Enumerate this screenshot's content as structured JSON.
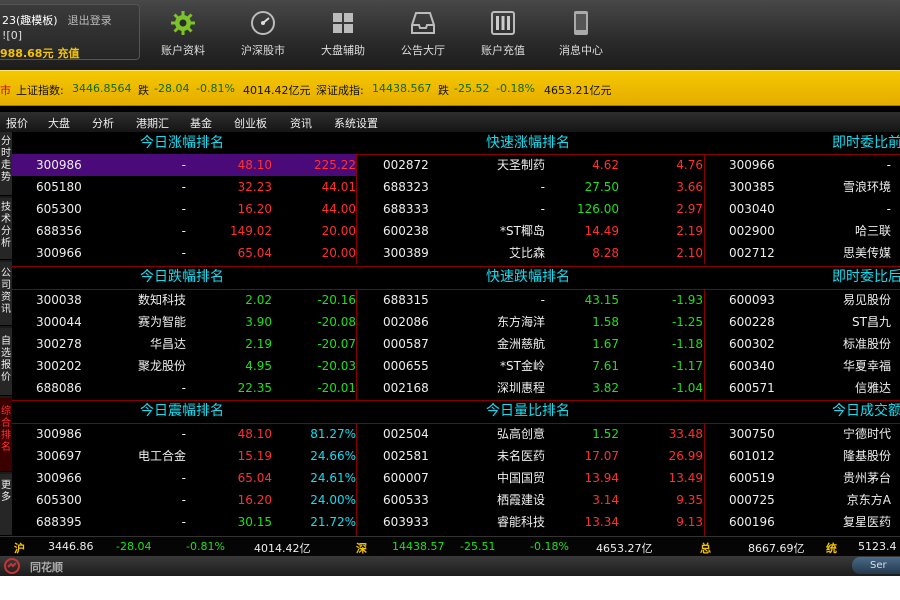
{
  "account": {
    "title": "23(趣模板)",
    "logout": "退出登录",
    "sub": "![0]",
    "balance": "988.68元",
    "recharge": "充值"
  },
  "nav": [
    {
      "label": "账户资料",
      "icon": "gear-icon"
    },
    {
      "label": "沪深股市",
      "icon": "gauge-icon"
    },
    {
      "label": "大盘辅助",
      "icon": "grid-icon"
    },
    {
      "label": "公告大厅",
      "icon": "inbox-icon"
    },
    {
      "label": "账户充值",
      "icon": "sliders-icon"
    },
    {
      "label": "消息中心",
      "icon": "phone-icon"
    }
  ],
  "ticker": {
    "lead": "市",
    "sh_label": "上证指数:",
    "sh_val": "3446.8564",
    "sh_dir": "跌",
    "sh_chg": "-28.04",
    "sh_pct": "-0.81%",
    "sh_amt": "4014.42亿元",
    "sz_label": "深证成指:",
    "sz_val": "14438.567",
    "sz_dir": "跌",
    "sz_chg": "-25.52",
    "sz_pct": "-0.18%",
    "sz_amt": "4653.21亿元"
  },
  "menu": [
    "报价",
    "大盘",
    "分析",
    "港期汇",
    "基金",
    "创业板",
    "资讯",
    "系统设置"
  ],
  "sidetabs": [
    "分时走势",
    "技术分析",
    "公司资讯",
    "自选报价",
    "综合排名",
    "更多"
  ],
  "panels": {
    "headers": [
      "今日涨幅排名",
      "快速涨幅排名",
      "即时委比前",
      "今日跌幅排名",
      "快速跌幅排名",
      "即时委比后",
      "今日震幅排名",
      "今日量比排名",
      "今日成交额"
    ],
    "block1": {
      "left": [
        [
          "300986",
          "-",
          "48.10",
          "225.22"
        ],
        [
          "605180",
          "-",
          "32.23",
          "44.01"
        ],
        [
          "605300",
          "-",
          "16.20",
          "44.00"
        ],
        [
          "688356",
          "-",
          "149.02",
          "20.00"
        ],
        [
          "300966",
          "-",
          "65.04",
          "20.00"
        ]
      ],
      "mid": [
        [
          "002872",
          "天圣制药",
          "4.62",
          "4.76"
        ],
        [
          "688323",
          "-",
          "27.50",
          "3.66"
        ],
        [
          "688333",
          "-",
          "126.00",
          "2.97"
        ],
        [
          "600238",
          "*ST椰岛",
          "14.49",
          "2.19"
        ],
        [
          "300389",
          "艾比森",
          "8.28",
          "2.10"
        ]
      ],
      "right": [
        [
          "300966",
          "-"
        ],
        [
          "300385",
          "雪浪环境"
        ],
        [
          "003040",
          "-"
        ],
        [
          "002900",
          "哈三联"
        ],
        [
          "002712",
          "思美传媒"
        ]
      ]
    },
    "block2": {
      "left": [
        [
          "300038",
          "数知科技",
          "2.02",
          "-20.16"
        ],
        [
          "300044",
          "赛为智能",
          "3.90",
          "-20.08"
        ],
        [
          "300278",
          "华昌达",
          "2.19",
          "-20.07"
        ],
        [
          "300202",
          "聚龙股份",
          "4.95",
          "-20.03"
        ],
        [
          "688086",
          "-",
          "22.35",
          "-20.01"
        ]
      ],
      "mid": [
        [
          "688315",
          "-",
          "43.15",
          "-1.93"
        ],
        [
          "002086",
          "东方海洋",
          "1.58",
          "-1.25"
        ],
        [
          "000587",
          "金洲慈航",
          "1.67",
          "-1.18"
        ],
        [
          "000655",
          "*ST金岭",
          "7.61",
          "-1.17"
        ],
        [
          "002168",
          "深圳惠程",
          "3.82",
          "-1.04"
        ]
      ],
      "right": [
        [
          "600093",
          "易见股份"
        ],
        [
          "600228",
          "ST昌九"
        ],
        [
          "600302",
          "标准股份"
        ],
        [
          "600340",
          "华夏幸福"
        ],
        [
          "600571",
          "信雅达"
        ]
      ]
    },
    "block3": {
      "left": [
        [
          "300986",
          "-",
          "48.10",
          "81.27%"
        ],
        [
          "300697",
          "电工合金",
          "15.19",
          "24.66%"
        ],
        [
          "300966",
          "-",
          "65.04",
          "24.61%"
        ],
        [
          "605300",
          "-",
          "16.20",
          "24.00%"
        ],
        [
          "688395",
          "-",
          "30.15",
          "21.72%"
        ]
      ],
      "mid": [
        [
          "002504",
          "弘高创意",
          "1.52",
          "33.48"
        ],
        [
          "002581",
          "未名医药",
          "17.07",
          "26.99"
        ],
        [
          "600007",
          "中国国贸",
          "13.94",
          "13.49"
        ],
        [
          "600533",
          "栖霞建设",
          "3.14",
          "9.35"
        ],
        [
          "603933",
          "睿能科技",
          "13.34",
          "9.13"
        ]
      ],
      "right": [
        [
          "300750",
          "宁德时代"
        ],
        [
          "601012",
          "隆基股份"
        ],
        [
          "600519",
          "贵州茅台"
        ],
        [
          "000725",
          "京东方A"
        ],
        [
          "600196",
          "复星医药"
        ]
      ]
    }
  },
  "status": {
    "hu": "沪",
    "hu_val": "3446.86",
    "hu_chg": "-28.04",
    "hu_pct": "-0.81%",
    "hu_amt": "4014.42亿",
    "shen": "深",
    "shen_val": "14438.57",
    "shen_chg": "-25.51",
    "shen_pct": "-0.18%",
    "shen_amt": "4653.27亿",
    "zong": "总",
    "zong_amt": "8667.69亿",
    "tong": "统",
    "tong_val": "5123.4"
  },
  "bottom": {
    "brand": "同花顺",
    "button": "Ser"
  }
}
